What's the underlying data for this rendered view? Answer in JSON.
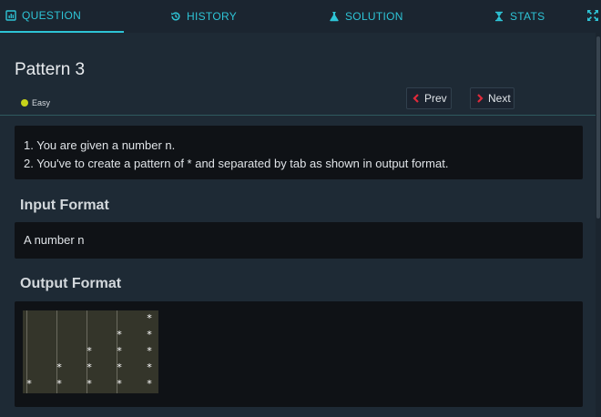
{
  "tabs": [
    {
      "label": "QUESTION",
      "icon": "document-chart-icon",
      "active": true
    },
    {
      "label": "HISTORY",
      "icon": "history-icon",
      "active": false
    },
    {
      "label": "SOLUTION",
      "icon": "flask-icon",
      "active": false
    },
    {
      "label": "STATS",
      "icon": "hourglass-icon",
      "active": false
    }
  ],
  "problem": {
    "title": "Pattern 3",
    "difficulty": "Easy",
    "difficulty_color": "#c7d31a",
    "prev_label": "Prev",
    "next_label": "Next",
    "statement": [
      "1. You are given a number n.",
      "2. You've to create a pattern of * and separated by tab as shown in output format."
    ]
  },
  "input_format": {
    "heading": "Input Format",
    "text": "A number n"
  },
  "output_format": {
    "heading": "Output Format",
    "pattern_rows": [
      "\t\t\t\t*",
      "\t\t\t*\t*",
      "\t\t*\t*\t*",
      "\t*\t*\t*\t*",
      "*\t*\t*\t*\t*"
    ]
  },
  "colors": {
    "accent": "#2ec4d6",
    "background": "#1e2a35",
    "panel": "#0f1216",
    "nav_arrow": "#e02a3a"
  }
}
